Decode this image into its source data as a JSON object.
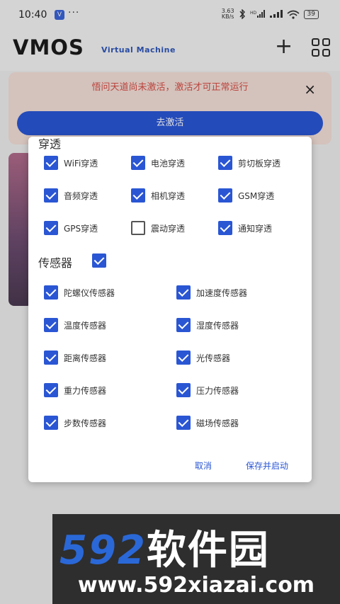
{
  "status_bar": {
    "time": "10:40",
    "app_icon": "V",
    "dots": "···",
    "speed_top": "3.63",
    "speed_bottom": "KB/s",
    "battery": "39"
  },
  "header": {
    "logo": "VMOS",
    "subtitle": "Virtual Machine",
    "plus_icon": "+"
  },
  "banner": {
    "message": "悟问天道尚未激活，激活才可正常运行",
    "close": "×",
    "activate_label": "去激活"
  },
  "dialog": {
    "passthrough_title": "穿透",
    "passthrough": [
      {
        "label": "WiFi穿透",
        "checked": true
      },
      {
        "label": "电池穿透",
        "checked": true
      },
      {
        "label": "剪切板穿透",
        "checked": true
      },
      {
        "label": "音频穿透",
        "checked": true
      },
      {
        "label": "相机穿透",
        "checked": true
      },
      {
        "label": "GSM穿透",
        "checked": true
      },
      {
        "label": "GPS穿透",
        "checked": true
      },
      {
        "label": "震动穿透",
        "checked": false
      },
      {
        "label": "通知穿透",
        "checked": true
      }
    ],
    "sensor_title": "传感器",
    "sensor_checked": true,
    "sensors": [
      {
        "label": "陀螺仪传感器",
        "checked": true
      },
      {
        "label": "加速度传感器",
        "checked": true
      },
      {
        "label": "温度传感器",
        "checked": true
      },
      {
        "label": "湿度传感器",
        "checked": true
      },
      {
        "label": "距离传感器",
        "checked": true
      },
      {
        "label": "光传感器",
        "checked": true
      },
      {
        "label": "重力传感器",
        "checked": true
      },
      {
        "label": "压力传感器",
        "checked": true
      },
      {
        "label": "步数传感器",
        "checked": true
      },
      {
        "label": "磁场传感器",
        "checked": true
      }
    ],
    "cancel_label": "取消",
    "save_label": "保存并启动"
  },
  "watermark": {
    "title_num": "592",
    "title_cn": "软件园",
    "url": "www.592xiazai.com"
  }
}
